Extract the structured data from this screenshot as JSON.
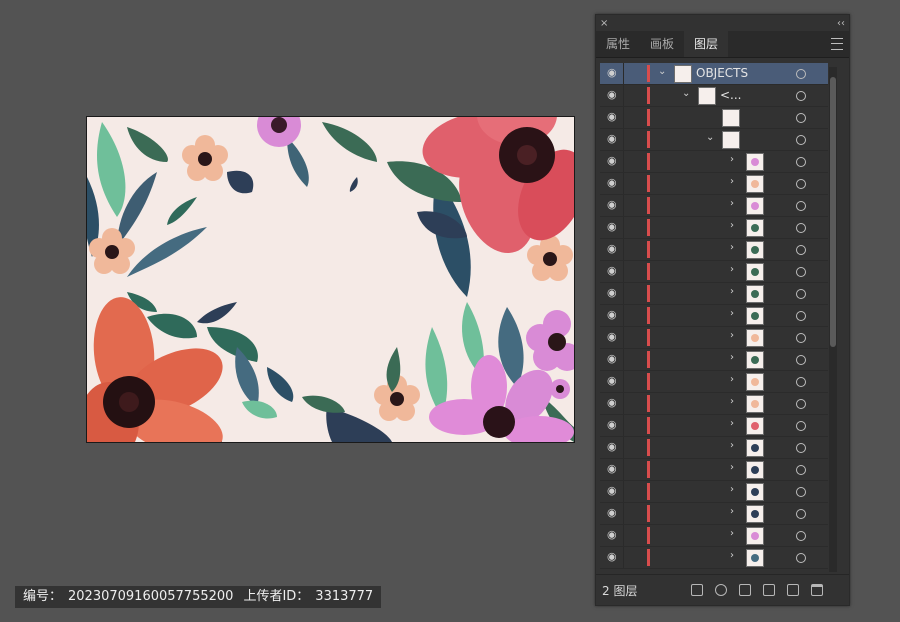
{
  "panel": {
    "tabs": [
      {
        "label": "属性"
      },
      {
        "label": "画板"
      },
      {
        "label": "图层"
      }
    ],
    "active_tab": "图层",
    "close_glyph": "×",
    "collapse_glyph": "‹‹",
    "layer_count": "2 图层",
    "layers": [
      {
        "label": "OBJECTS",
        "depth": 0,
        "expanded": true,
        "selected": true
      },
      {
        "label": "<...",
        "depth": 1,
        "expanded": true
      },
      {
        "label": "",
        "depth": 2,
        "expanded": null
      },
      {
        "label": "",
        "depth": 2,
        "expanded": true
      },
      {
        "label": "",
        "depth": 3,
        "thumb": "pink-flower"
      },
      {
        "label": "",
        "depth": 3,
        "thumb": "peach-flower"
      },
      {
        "label": "",
        "depth": 3,
        "thumb": "pink-flower"
      },
      {
        "label": "",
        "depth": 3,
        "thumb": "green-leaf"
      },
      {
        "label": "",
        "depth": 3,
        "thumb": "green-leaf"
      },
      {
        "label": "",
        "depth": 3,
        "thumb": "green-leaf"
      },
      {
        "label": "",
        "depth": 3,
        "thumb": "green-leaf"
      },
      {
        "label": "",
        "depth": 3,
        "thumb": "green-leaf"
      },
      {
        "label": "",
        "depth": 3,
        "thumb": "peach-flower"
      },
      {
        "label": "",
        "depth": 3,
        "thumb": "green-leaf"
      },
      {
        "label": "",
        "depth": 3,
        "thumb": "peach-flower"
      },
      {
        "label": "",
        "depth": 3,
        "thumb": "peach-flower"
      },
      {
        "label": "",
        "depth": 3,
        "thumb": "red-flower"
      },
      {
        "label": "",
        "depth": 3,
        "thumb": "navy-leaf"
      },
      {
        "label": "",
        "depth": 3,
        "thumb": "navy-leaf"
      },
      {
        "label": "",
        "depth": 3,
        "thumb": "navy-leaf"
      },
      {
        "label": "",
        "depth": 3,
        "thumb": "navy-leaf"
      },
      {
        "label": "",
        "depth": 3,
        "thumb": "pink-flower"
      },
      {
        "label": "",
        "depth": 3,
        "thumb": "teal-leaf"
      }
    ]
  },
  "watermark": {
    "id_label": "编号：",
    "id_value": "20230709160057755200",
    "uploader_label": "上传者ID：",
    "uploader_value": "3313777"
  },
  "colors": {
    "workspace": "#535353",
    "artboard": "#f5eae6",
    "layer_color": "#d84d4d",
    "selection": "#4a5c78"
  }
}
